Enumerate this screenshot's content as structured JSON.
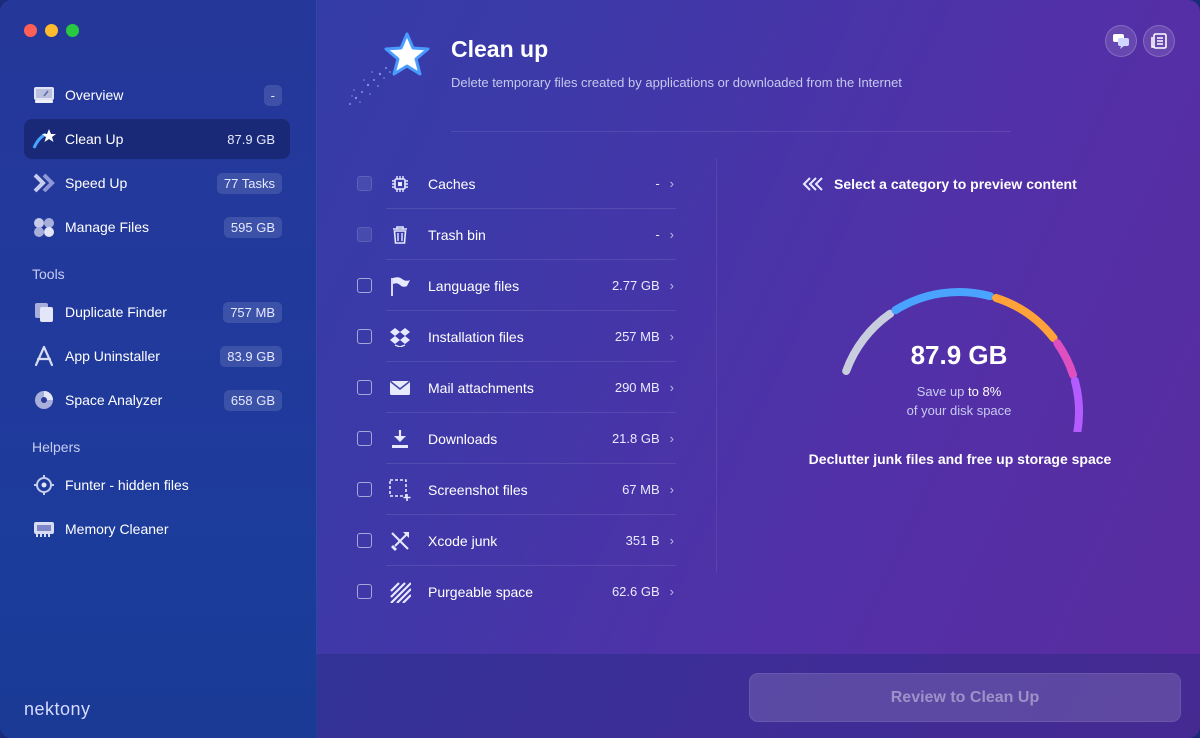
{
  "window": {
    "traffic_lights": [
      "close",
      "minimize",
      "zoom"
    ]
  },
  "sidebar": {
    "items": [
      {
        "label": "Overview",
        "badge": "-",
        "icon": "overview-icon",
        "active": false
      },
      {
        "label": "Clean Up",
        "badge": "87.9 GB",
        "icon": "clean-up-icon",
        "active": true
      },
      {
        "label": "Speed Up",
        "badge": "77 Tasks",
        "icon": "speed-up-icon",
        "active": false
      },
      {
        "label": "Manage Files",
        "badge": "595 GB",
        "icon": "manage-files-icon",
        "active": false
      }
    ],
    "tools_heading": "Tools",
    "tools": [
      {
        "label": "Duplicate Finder",
        "badge": "757 MB",
        "icon": "duplicate-finder-icon"
      },
      {
        "label": "App Uninstaller",
        "badge": "83.9 GB",
        "icon": "app-uninstaller-icon"
      },
      {
        "label": "Space Analyzer",
        "badge": "658 GB",
        "icon": "space-analyzer-icon"
      }
    ],
    "helpers_heading": "Helpers",
    "helpers": [
      {
        "label": "Funter - hidden files",
        "icon": "funter-icon"
      },
      {
        "label": "Memory Cleaner",
        "icon": "memory-cleaner-icon"
      }
    ],
    "brand": "nektony"
  },
  "header": {
    "title": "Clean up",
    "subtitle": "Delete temporary files created by applications or downloaded from the Internet",
    "buttons": [
      "chat-icon",
      "news-icon"
    ]
  },
  "categories": [
    {
      "label": "Caches",
      "size": "-",
      "icon": "chip-icon",
      "enabled": false
    },
    {
      "label": "Trash bin",
      "size": "-",
      "icon": "trash-icon",
      "enabled": false
    },
    {
      "label": "Language files",
      "size": "2.77 GB",
      "icon": "flag-icon",
      "enabled": true
    },
    {
      "label": "Installation files",
      "size": "257 MB",
      "icon": "dropbox-icon",
      "enabled": true
    },
    {
      "label": "Mail attachments",
      "size": "290 MB",
      "icon": "mail-icon",
      "enabled": true
    },
    {
      "label": "Downloads",
      "size": "21.8 GB",
      "icon": "download-icon",
      "enabled": true
    },
    {
      "label": "Screenshot files",
      "size": "67 MB",
      "icon": "screenshot-icon",
      "enabled": true
    },
    {
      "label": "Xcode junk",
      "size": "351 B",
      "icon": "hammer-icon",
      "enabled": true
    },
    {
      "label": "Purgeable space",
      "size": "62.6 GB",
      "icon": "purgeable-icon",
      "enabled": true
    }
  ],
  "preview": {
    "hint": "Select a category to preview content",
    "gauge_value": "87.9 GB",
    "save_prefix": "Save up",
    "save_value": "to 8%",
    "disk_text": "of your disk space",
    "declutter": "Declutter junk files and free up storage space",
    "gauge_colors": [
      "#c9cede",
      "#4aa3ff",
      "#ffa23a",
      "#e04fc0",
      "#b45cff",
      "#5ad06a"
    ]
  },
  "footer": {
    "review_button": "Review to Clean Up"
  }
}
